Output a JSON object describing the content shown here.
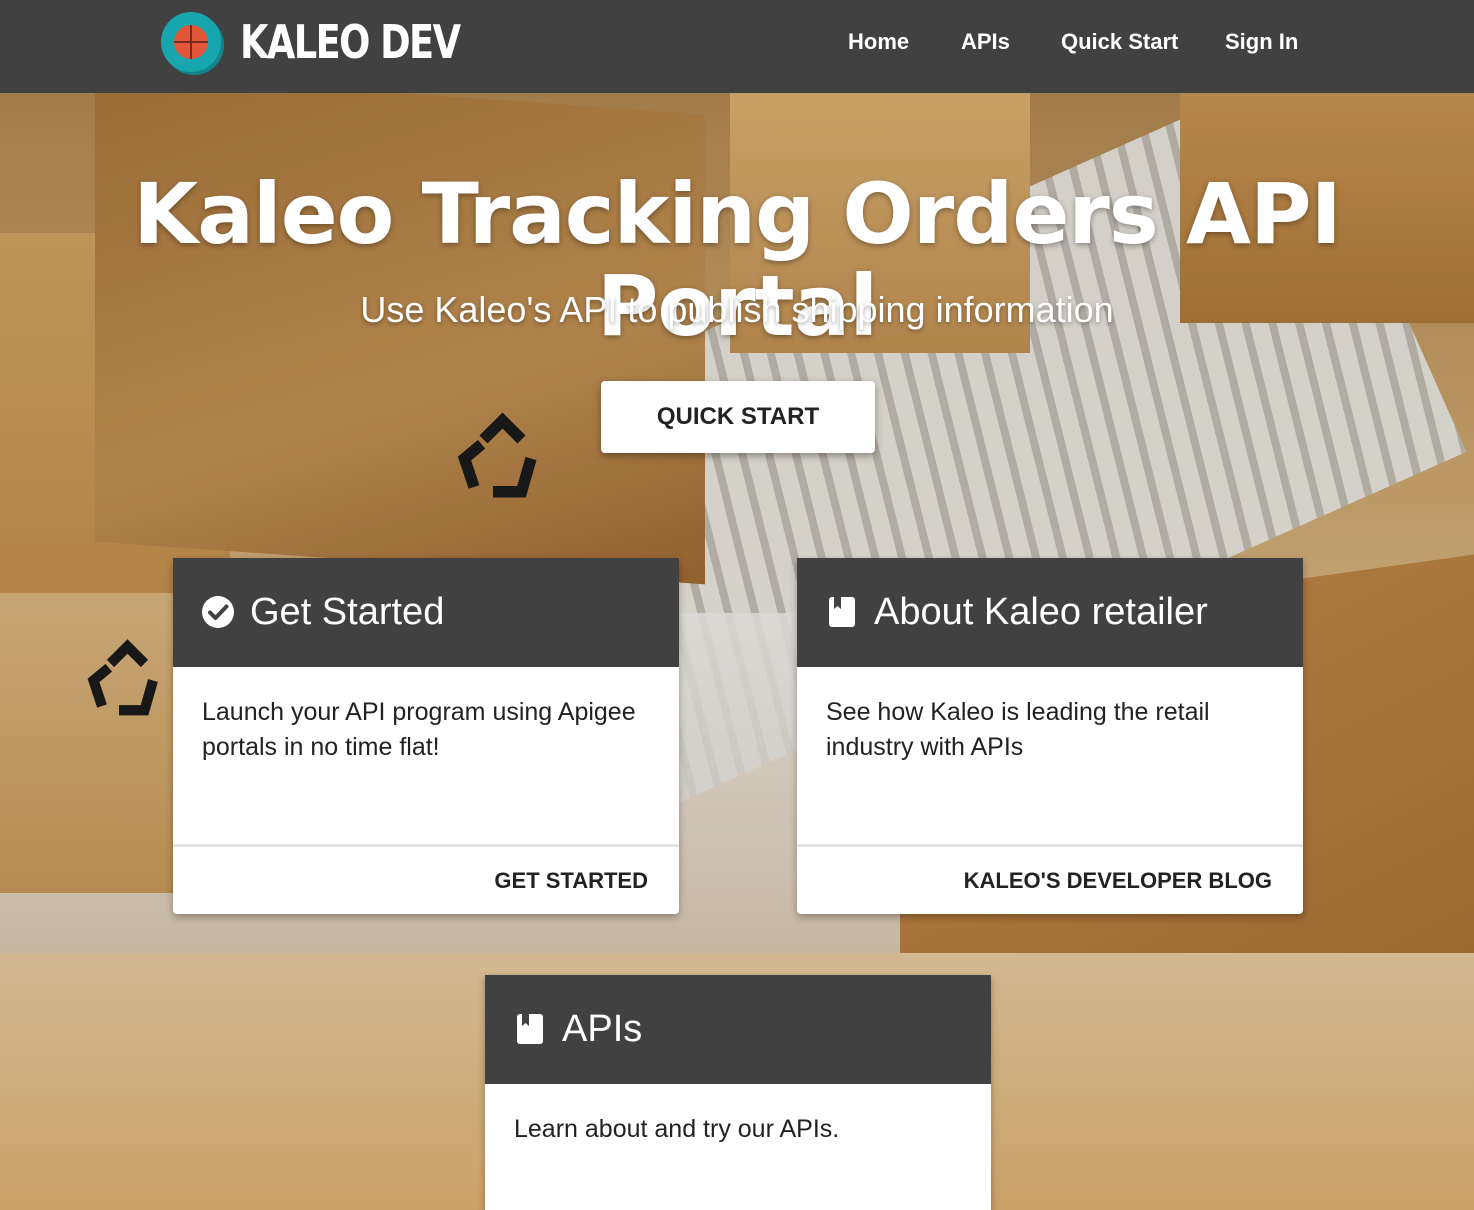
{
  "nav": {
    "brand": "KALEO DEV",
    "links": [
      "Home",
      "APIs",
      "Quick Start",
      "Sign In"
    ]
  },
  "hero": {
    "title": "Kaleo Tracking Orders API Portal",
    "subtitle": "Use Kaleo's API to publish shipping information",
    "button_label": "QUICK START"
  },
  "cards": [
    {
      "icon": "check-circle-icon",
      "title": "Get Started",
      "body": "Launch your API program using Apigee portals in no time flat!",
      "action": "GET STARTED"
    },
    {
      "icon": "book-icon",
      "title": "About Kaleo retailer",
      "body": "See how Kaleo is leading the retail industry with APIs",
      "action": "KALEO'S DEVELOPER BLOG"
    },
    {
      "icon": "book-icon",
      "title": "APIs",
      "body": "Learn about and try our APIs."
    }
  ],
  "colors": {
    "navbar": "#414141",
    "card_header": "#414141",
    "logo_teal": "#17a6ad",
    "logo_ball": "#e2573a"
  }
}
